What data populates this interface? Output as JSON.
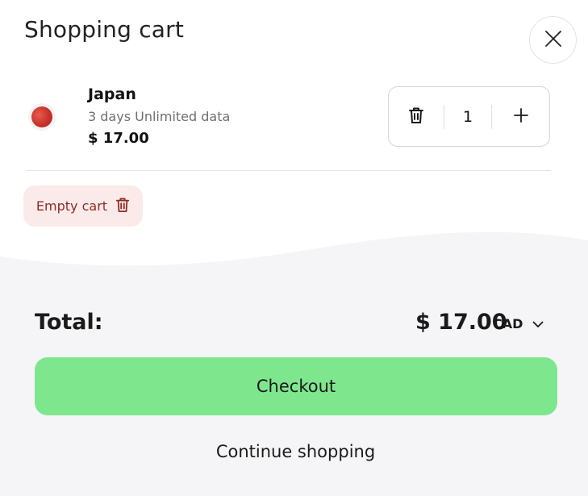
{
  "header": {
    "title": "Shopping cart",
    "close_icon": "close-icon"
  },
  "cart": {
    "items": [
      {
        "flag_icon": "japan-flag-icon",
        "name": "Japan",
        "description": "3 days Unlimited data",
        "price": "$ 17.00",
        "quantity": "1",
        "remove_icon": "trash-icon",
        "increment_icon": "plus-icon"
      }
    ],
    "empty_label": "Empty cart",
    "empty_icon": "trash-icon"
  },
  "summary": {
    "total_label": "Total:",
    "total_amount": "$ 17.00",
    "currency": "CAD",
    "currency_icon": "chevron-down-icon"
  },
  "actions": {
    "checkout_label": "Checkout",
    "continue_label": "Continue shopping"
  },
  "colors": {
    "checkout_green": "#7ee78e",
    "empty_cart_bg": "#fbeaea",
    "empty_cart_text": "#8e2c24",
    "footer_bg": "#f5f5f7",
    "flag_red": "#c8322a"
  }
}
